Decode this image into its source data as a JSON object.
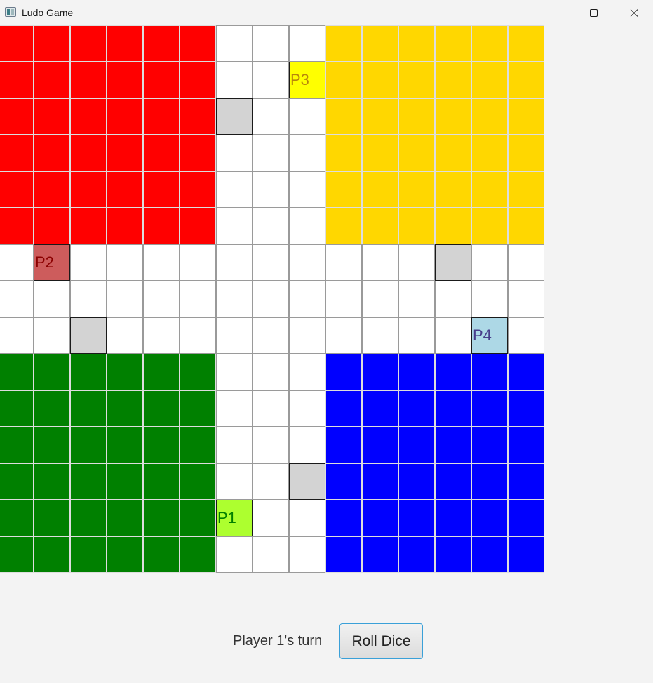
{
  "window": {
    "title": "Ludo Game",
    "icon": "app-icon",
    "controls": [
      "minimize-icon",
      "maximize-icon",
      "close-icon"
    ]
  },
  "board": {
    "size": 15,
    "home_colors": {
      "red": "#ff0000",
      "yellow": "#ffd700",
      "green": "#008000",
      "blue": "#0000ff"
    },
    "path_color": "#ffffff",
    "safe_color": "#d3d3d3",
    "safe_cells": [
      [
        2,
        6
      ],
      [
        6,
        12
      ],
      [
        8,
        2
      ],
      [
        12,
        8
      ]
    ],
    "tokens": [
      {
        "label": "P1",
        "row": 13,
        "col": 6,
        "bg": "#adff2f",
        "fg": "#008000"
      },
      {
        "label": "P2",
        "row": 6,
        "col": 1,
        "bg": "#cd5c5c",
        "fg": "#8b0000"
      },
      {
        "label": "P3",
        "row": 1,
        "col": 8,
        "bg": "#ffff00",
        "fg": "#b8860b"
      },
      {
        "label": "P4",
        "row": 8,
        "col": 13,
        "bg": "#add8e6",
        "fg": "#483d8b"
      }
    ]
  },
  "status": {
    "turn_text": "Player 1's turn",
    "roll_button_label": "Roll Dice"
  }
}
